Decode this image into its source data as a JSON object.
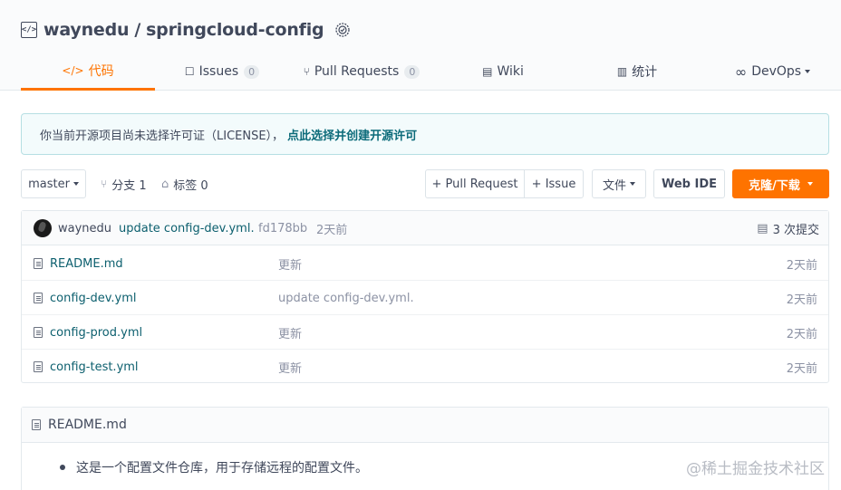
{
  "repo": {
    "owner": "waynedu",
    "separator": "/",
    "name": "springcloud-config",
    "icon": "code-icon"
  },
  "tabs": [
    {
      "label": "代码",
      "icon": "</>"
    },
    {
      "label": "Issues",
      "count": "0",
      "icon": "☐"
    },
    {
      "label": "Pull Requests",
      "count": "0",
      "icon": "⑂"
    },
    {
      "label": "Wiki",
      "icon": "▤"
    },
    {
      "label": "统计",
      "icon": "▥"
    },
    {
      "label": "DevOps",
      "icon": "∞"
    }
  ],
  "notice": {
    "text": "你当前开源项目尚未选择许可证（LICENSE），",
    "link": "点此选择并创建开源许可"
  },
  "toolbar": {
    "branch": "master",
    "branches_label": "分支 1",
    "tags_label": "标签 0",
    "pull_request": "+ Pull Request",
    "issue": "+ Issue",
    "files": "文件",
    "web_ide": "Web IDE",
    "clone": "克隆/下载"
  },
  "latest_commit": {
    "author": "waynedu",
    "message": "update config-dev.yml.",
    "hash": "fd178bb",
    "time": "2天前",
    "commits_label": "3 次提交"
  },
  "files": [
    {
      "name": "README.md",
      "message": "更新",
      "time": "2天前"
    },
    {
      "name": "config-dev.yml",
      "message": "update config-dev.yml.",
      "time": "2天前"
    },
    {
      "name": "config-prod.yml",
      "message": "更新",
      "time": "2天前"
    },
    {
      "name": "config-test.yml",
      "message": "更新",
      "time": "2天前"
    }
  ],
  "readme": {
    "title": "README.md",
    "content": "这是一个配置文件仓库，用于存储远程的配置文件。"
  },
  "watermark": "@稀土掘金技术社区",
  "colors": {
    "accent": "#fe7300",
    "link": "#0c5f6e",
    "notice_bg": "#f3fbfc"
  }
}
